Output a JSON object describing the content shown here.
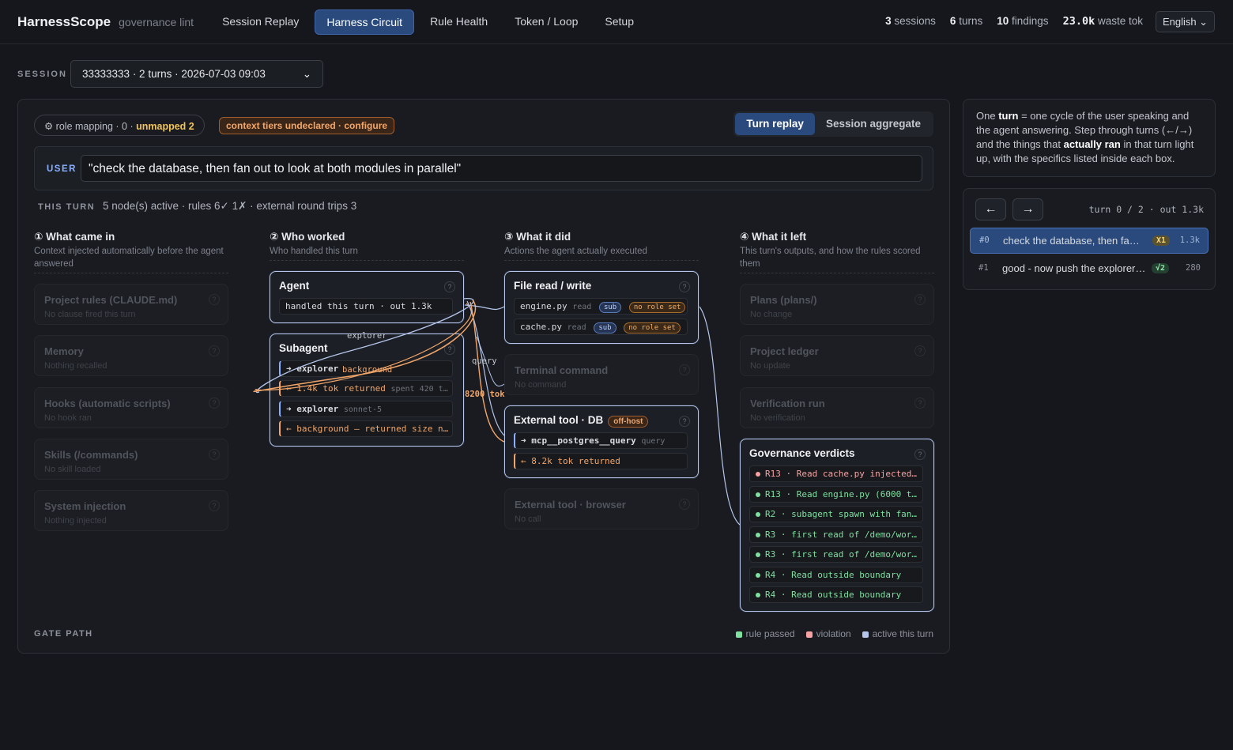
{
  "app": {
    "brand": "HarnessScope",
    "subtitle": "governance lint"
  },
  "nav": [
    {
      "label": "Session Replay",
      "active": false
    },
    {
      "label": "Harness Circuit",
      "active": true
    },
    {
      "label": "Rule Health",
      "active": false
    },
    {
      "label": "Token / Loop",
      "active": false
    },
    {
      "label": "Setup",
      "active": false
    }
  ],
  "stats": {
    "sessions_n": "3",
    "sessions_l": "sessions",
    "turns_n": "6",
    "turns_l": "turns",
    "findings_n": "10",
    "findings_l": "findings",
    "waste_n": "23.0k",
    "waste_l": "waste tok"
  },
  "language": "English",
  "session": {
    "label": "SESSION",
    "selected": "33333333 · 2 turns · 2026-07-03 09:03"
  },
  "chips": {
    "role_prefix": "⚙ role mapping · 0 ·",
    "role_warn": "unmapped 2",
    "context": "context tiers undeclared · configure"
  },
  "view_toggle": {
    "turn": "Turn replay",
    "aggregate": "Session aggregate"
  },
  "user": {
    "tag": "USER",
    "text": "\"check the database, then fan out to look at both modules in parallel\""
  },
  "this_turn": {
    "label": "THIS TURN",
    "summary": "5 node(s) active · rules 6✓ 1✗ · external round trips 3"
  },
  "columns": [
    {
      "title": "① What came in",
      "subtitle": "Context injected automatically before the agent answered"
    },
    {
      "title": "② Who worked",
      "subtitle": "Who handled this turn"
    },
    {
      "title": "③ What it did",
      "subtitle": "Actions the agent actually executed"
    },
    {
      "title": "④ What it left",
      "subtitle": "This turn's outputs, and how the rules scored them"
    }
  ],
  "came_in": [
    {
      "title": "Project rules (CLAUDE.md)",
      "sub": "No clause fired this turn"
    },
    {
      "title": "Memory",
      "sub": "Nothing recalled"
    },
    {
      "title": "Hooks (automatic scripts)",
      "sub": "No hook ran"
    },
    {
      "title": "Skills (/commands)",
      "sub": "No skill loaded"
    },
    {
      "title": "System injection",
      "sub": "Nothing injected"
    }
  ],
  "agent": {
    "title": "Agent",
    "row": "handled this turn · out 1.3k"
  },
  "subagent": {
    "title": "Subagent",
    "rows": [
      {
        "dir": "➜",
        "text": "explorer",
        "extra": "background"
      },
      {
        "dir": "←",
        "text": "1.4k tok returned",
        "extra": "spent 420 t…"
      },
      {
        "dir": "➜",
        "text": "explorer",
        "extra": "sonnet-5"
      },
      {
        "dir": "←",
        "text": "background — returned size n…",
        "extra": ""
      }
    ]
  },
  "file_rw": {
    "title": "File read / write",
    "rows": [
      {
        "name": "engine.py",
        "op": "read",
        "tag": "sub",
        "warn": "no role set"
      },
      {
        "name": "cache.py",
        "op": "read",
        "tag": "sub",
        "warn": "no role set"
      }
    ]
  },
  "terminal": {
    "title": "Terminal command",
    "sub": "No command"
  },
  "ext_db": {
    "title": "External tool · DB",
    "badge": "off-host",
    "rows": [
      {
        "dir": "➜",
        "text": "mcp__postgres__query",
        "extra": "query"
      },
      {
        "dir": "←",
        "text": "8.2k tok returned",
        "extra": ""
      }
    ]
  },
  "ext_browser": {
    "title": "External tool · browser",
    "sub": "No call"
  },
  "left": [
    {
      "title": "Plans (plans/)",
      "sub": "No change"
    },
    {
      "title": "Project ledger",
      "sub": "No update"
    },
    {
      "title": "Verification run",
      "sub": "No verification"
    }
  ],
  "verdicts": {
    "title": "Governance verdicts",
    "items": [
      {
        "text": "R13 · Read cache.py injected…",
        "ok": false
      },
      {
        "text": "R13 · Read engine.py (6000 t…",
        "ok": true
      },
      {
        "text": "R2 · subagent spawn with fan…",
        "ok": true
      },
      {
        "text": "R3 · first read of /demo/wor…",
        "ok": true
      },
      {
        "text": "R3 · first read of /demo/wor…",
        "ok": true
      },
      {
        "text": "R4 · Read outside boundary",
        "ok": true
      },
      {
        "text": "R4 · Read outside boundary",
        "ok": true
      }
    ]
  },
  "wire_labels": {
    "explorer": "explorer",
    "background": "background",
    "query": "query",
    "tok": "8200 tok"
  },
  "gate_path": "GATE PATH",
  "legend": {
    "passed": "rule passed",
    "violation": "violation",
    "active": "active this turn"
  },
  "colors": {
    "accent": "#2a4a7d",
    "active_border": "#b5c6ea",
    "pass": "#7fe0a0",
    "violation": "#f7a3a3",
    "incoming": "#f2a66a",
    "outgoing": "#8ab0ff"
  },
  "info": {
    "p1": "One ",
    "b1": "turn",
    "p2": " = one cycle of the user speaking and the agent answering. Step through turns (←/→) and the things that ",
    "b2": "actually ran",
    "p3": " in that turn light up, with the specifics listed inside each box."
  },
  "turn_nav": {
    "prev": "←",
    "next": "→",
    "counter": "turn 0 / 2 · out 1.3k",
    "items": [
      {
        "index": "#0",
        "text": "check the database, then fa…",
        "badge": "X1",
        "tokens": "1.3k",
        "selected": true
      },
      {
        "index": "#1",
        "text": "good - now push the explorer…",
        "badge": "√2",
        "tokens": "280",
        "selected": false
      }
    ]
  }
}
